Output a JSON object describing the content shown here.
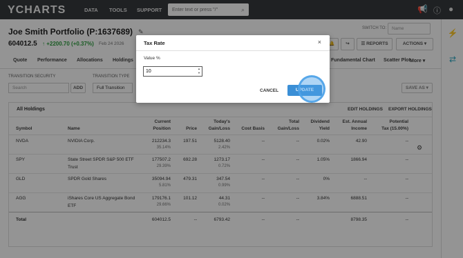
{
  "nav": {
    "logo": "YCHARTS",
    "links": [
      "DATA",
      "TOOLS",
      "SUPPORT"
    ],
    "search_placeholder": "Enter text or press \"/\"",
    "icons": [
      "search-icon",
      "megaphone-icon",
      "info-icon",
      "user-icon"
    ]
  },
  "sidebar": {
    "icons": [
      "lightning-icon",
      "swap-icon"
    ]
  },
  "header": {
    "title": "Joe Smith Portfolio (P:1637689)",
    "value": "604012.5",
    "change": "+2200.70 (+0.37%)",
    "date": "Feb 24 2026",
    "switch_to": "SWITCH TO:",
    "name_placeholder": "Name",
    "reports": "REPORTS",
    "actions": "ACTIONS"
  },
  "tabs": [
    "Quote",
    "Performance",
    "Allocations",
    "Holdings",
    "Fundamental Chart",
    "Scatter Plot",
    "More"
  ],
  "transition_bar": {
    "security_label": "TRANSITION SECURITY",
    "search_placeholder": "Search",
    "add": "ADD",
    "type_label": "TRANSITION TYPE",
    "type_value": "Full Transition",
    "save_as": "SAVE AS"
  },
  "holdings": {
    "title": "All Holdings",
    "edit": "EDIT HOLDINGS",
    "export": "EXPORT HOLDINGS",
    "columns": {
      "symbol": "Symbol",
      "name": "Name",
      "position": [
        "Current",
        "Position"
      ],
      "price": "Price",
      "gain": [
        "Today's",
        "Gain/Loss"
      ],
      "basis": "Cost Basis",
      "total": [
        "Total",
        "Gain/Loss"
      ],
      "yield": [
        "Dividend",
        "Yield"
      ],
      "income": [
        "Est. Annual",
        "Income"
      ],
      "tax": [
        "Potential",
        "Tax (15.00%)"
      ]
    },
    "rows": [
      {
        "symbol": "NVDA",
        "name": "NVIDIA Corp.",
        "name2": "",
        "position": "212234.3",
        "position_pct": "35.14%",
        "price": "197.51",
        "gain": "5128.40",
        "gain_pct": "2.42%",
        "basis": "--",
        "total": "--",
        "yield": "0.02%",
        "income": "42.90",
        "tax": "--"
      },
      {
        "symbol": "SPY",
        "name": "State Street SPDR S&P 500 ETF",
        "name2": "Trust",
        "position": "177507.2",
        "position_pct": "29.39%",
        "price": "692.28",
        "gain": "1273.17",
        "gain_pct": "0.72%",
        "basis": "--",
        "total": "--",
        "yield": "1.05%",
        "income": "1866.94",
        "tax": "--"
      },
      {
        "symbol": "GLD",
        "name": "SPDR Gold Shares",
        "name2": "",
        "position": "35094.94",
        "position_pct": "5.81%",
        "price": "479.31",
        "gain": "347.54",
        "gain_pct": "0.99%",
        "basis": "--",
        "total": "--",
        "yield": "0%",
        "income": "--",
        "tax": "--"
      },
      {
        "symbol": "AGG",
        "name": "iShares Core US Aggregate Bond",
        "name2": "ETF",
        "position": "179176.1",
        "position_pct": "29.66%",
        "price": "101.12",
        "gain": "44.31",
        "gain_pct": "0.02%",
        "basis": "--",
        "total": "--",
        "yield": "3.84%",
        "income": "6888.51",
        "tax": "--"
      }
    ],
    "total": {
      "label": "Total",
      "position": "604012.5",
      "price": "--",
      "gain": "6793.42",
      "basis": "--",
      "total": "--",
      "yield": "",
      "income": "8798.35",
      "tax": "--"
    }
  },
  "modal": {
    "title": "Tax Rate",
    "close": "×",
    "label": "Value %",
    "value": "10",
    "cancel": "CANCEL",
    "update": "UPDATE"
  }
}
